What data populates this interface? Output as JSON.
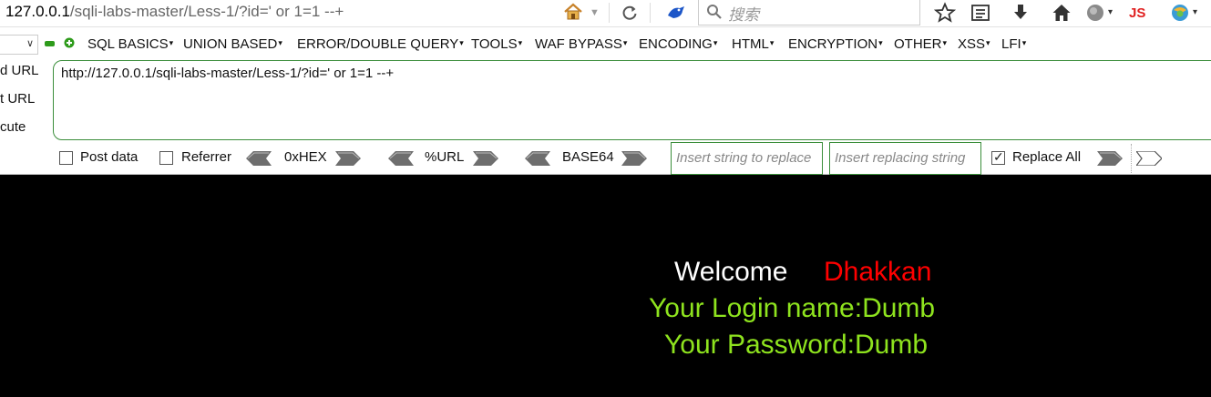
{
  "browser": {
    "url_host": "127.0.0.1",
    "url_path": "/sqli-labs-master/Less-1/?id=' or 1=1 --+",
    "search_placeholder": "搜索"
  },
  "hackbar": {
    "menu": [
      "SQL BASICS",
      "UNION BASED",
      "ERROR/DOUBLE QUERY",
      "TOOLS",
      "WAF BYPASS",
      "ENCODING",
      "HTML",
      "ENCRYPTION",
      "OTHER",
      "XSS",
      "LFI"
    ],
    "side_labels": [
      "d URL",
      "t URL",
      "cute"
    ],
    "url_value": "http://127.0.0.1/sqli-labs-master/Less-1/?id=' or 1=1 --+",
    "post_data_label": "Post data",
    "referrer_label": "Referrer",
    "enc_hex": "0xHEX",
    "enc_url": "%URL",
    "enc_base64": "BASE64",
    "replace_placeholder": "Insert string to replace",
    "replacing_placeholder": "Insert replacing string",
    "replace_all_label": "Replace All"
  },
  "page": {
    "welcome": "Welcome",
    "user": "Dhakkan",
    "login": "Your Login name:Dumb",
    "password": "Your Password:Dumb"
  }
}
